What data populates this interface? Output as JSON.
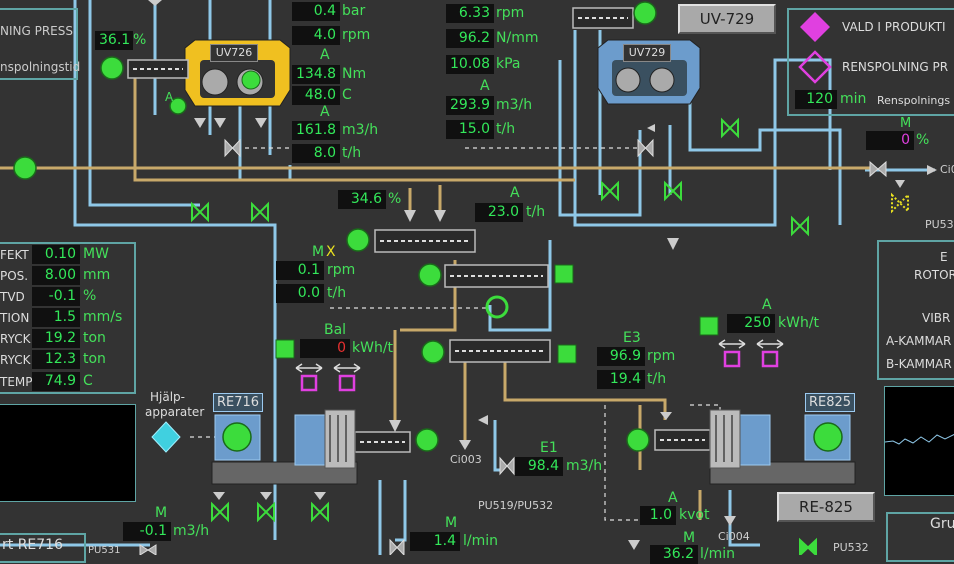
{
  "colors": {
    "background": "#333333",
    "pipe_blue": "#8fc8e8",
    "pipe_tan": "#c8a96a",
    "value_green": "#33e85a",
    "running_green": "#3cdc3c",
    "panel_teal": "#5fa5a5",
    "magenta": "#e040e0",
    "yellow_machine": "#f0c020",
    "blue_machine": "#6c9ccc"
  },
  "top_left": {
    "label1": "NING PRESS",
    "label2": "nspolningstid",
    "pct": "36.1",
    "pct_unit": "%"
  },
  "uv726": {
    "tag": "UV726",
    "a_label": "A"
  },
  "uv729": {
    "tag": "UV729",
    "button": "UV-729"
  },
  "mid_values": [
    {
      "value": "0.4",
      "unit": "bar"
    },
    {
      "value": "4.0",
      "unit": "rpm"
    },
    {
      "value": "134.8",
      "unit": "Nm",
      "prefix": "A"
    },
    {
      "value": "48.0",
      "unit": "C"
    },
    {
      "value": "161.8",
      "unit": "m3/h",
      "prefix": "A"
    },
    {
      "value": "8.0",
      "unit": "t/h"
    }
  ],
  "right_values": [
    {
      "value": "6.33",
      "unit": "rpm"
    },
    {
      "value": "96.2",
      "unit": "N/mm"
    },
    {
      "value": "10.08",
      "unit": "kPa"
    },
    {
      "value": "293.9",
      "unit": "m3/h",
      "prefix": "A"
    },
    {
      "value": "15.0",
      "unit": "t/h"
    }
  ],
  "legend": {
    "item1": "VALD I PRODUKTI",
    "item2": "RENSPOLNING PR",
    "minutes": "120",
    "minutes_unit": "min",
    "rens_label": "Renspolnings"
  },
  "right_valve": {
    "m_label": "M",
    "value": "0",
    "unit": "%",
    "ci": "Ci0",
    "pu": "PU53"
  },
  "screw_top": {
    "pct": "34.6",
    "pct_unit": "%",
    "a_label": "A",
    "th": "23.0",
    "th_unit": "t/h"
  },
  "mx_values": {
    "mx_label": "M",
    "x_label": "X",
    "rpm": "0.1",
    "rpm_unit": "rpm",
    "th": "0.0",
    "th_unit": "t/h"
  },
  "left_panel": [
    {
      "label": "FEKT",
      "value": "0.10",
      "unit": "MW"
    },
    {
      "label": "POS.",
      "value": "8.00",
      "unit": "mm"
    },
    {
      "label": "TVD",
      "value": "-0.1",
      "unit": "%"
    },
    {
      "label": "TION",
      "value": "1.5",
      "unit": "mm/s"
    },
    {
      "label": "RYCK",
      "value": "19.2",
      "unit": "ton"
    },
    {
      "label": "RYCK",
      "value": "12.3",
      "unit": "ton"
    },
    {
      "label": "TEMP",
      "value": "74.9",
      "unit": "C"
    }
  ],
  "bal": {
    "label": "Bal",
    "value": "0",
    "unit": "kWh/t"
  },
  "energy": {
    "a_label": "A",
    "value": "250",
    "unit": "kWh/t"
  },
  "e3": {
    "label": "E3",
    "rpm": "96.9",
    "rpm_unit": "rpm",
    "th": "19.4",
    "th_unit": "t/h"
  },
  "right_panel": {
    "l1": "E",
    "l2": "ROTOR",
    "l3": "VIBR",
    "l4": "A-KAMMAR",
    "l5": "B-KAMMAR"
  },
  "re716": {
    "tag": "RE716",
    "hjalp1": "Hjälp-",
    "hjalp2": "apparater"
  },
  "re825": {
    "tag": "RE825",
    "button": "RE-825"
  },
  "e1": {
    "label": "E1",
    "value": "98.4",
    "unit": "m3/h",
    "ci": "Ci003",
    "pu": "PU519/PU532"
  },
  "bottom": {
    "m_label1": "M",
    "flow": "-0.1",
    "flow_unit": "m3/h",
    "m_label2": "M",
    "lmin": "1.4",
    "lmin_unit": "l/min",
    "a_label": "A",
    "kvot": "1.0",
    "kvot_unit": "kvot",
    "m_label3": "M",
    "lmin2": "36.2",
    "lmin2_unit": "l/min",
    "ci004": "Ci004",
    "pu532": "PU532",
    "pu531": "PU531",
    "start": "rt RE716",
    "gru": "Gru"
  }
}
